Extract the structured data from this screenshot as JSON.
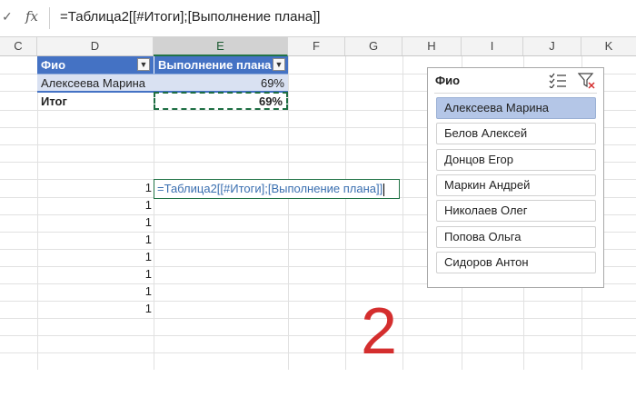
{
  "formula_bar": {
    "cancel_icon": "check-mark",
    "fx_label": "fx",
    "formula": "=Таблица2[[#Итоги];[Выполнение плана]]"
  },
  "columns": {
    "c": "C",
    "d": "D",
    "e": "E",
    "f": "F",
    "g": "G",
    "h": "H",
    "i": "I",
    "j": "J",
    "k": "K"
  },
  "table": {
    "header_fio": "Фио",
    "header_plan": "Выполнение плана",
    "row1_name": "Алексеева Марина",
    "row1_value": "69%",
    "total_label": "Итог",
    "total_value": "69%"
  },
  "numbers": [
    "1",
    "1",
    "1",
    "1",
    "1",
    "1",
    "1",
    "1"
  ],
  "editing_cell": {
    "text": "=Таблица2[[#Итоги];[Выполнение плана]]"
  },
  "slicer": {
    "title": "Фио",
    "multiselect_icon": "multi-select",
    "clear_filter_icon": "clear-filter",
    "items": [
      {
        "label": "Алексеева Марина",
        "selected": true
      },
      {
        "label": "Белов Алексей",
        "selected": false
      },
      {
        "label": "Донцов Егор",
        "selected": false
      },
      {
        "label": "Маркин Андрей",
        "selected": false
      },
      {
        "label": "Николаев Олег",
        "selected": false
      },
      {
        "label": "Попова Ольга",
        "selected": false
      },
      {
        "label": "Сидоров Антон",
        "selected": false
      }
    ],
    "selected_color": "#b4c6e7"
  },
  "overlay": {
    "big_number": "2",
    "color": "#d42e2e"
  },
  "colors": {
    "table_header": "#4472c4",
    "table_band": "#d9e1f2",
    "selection_green": "#217346"
  }
}
